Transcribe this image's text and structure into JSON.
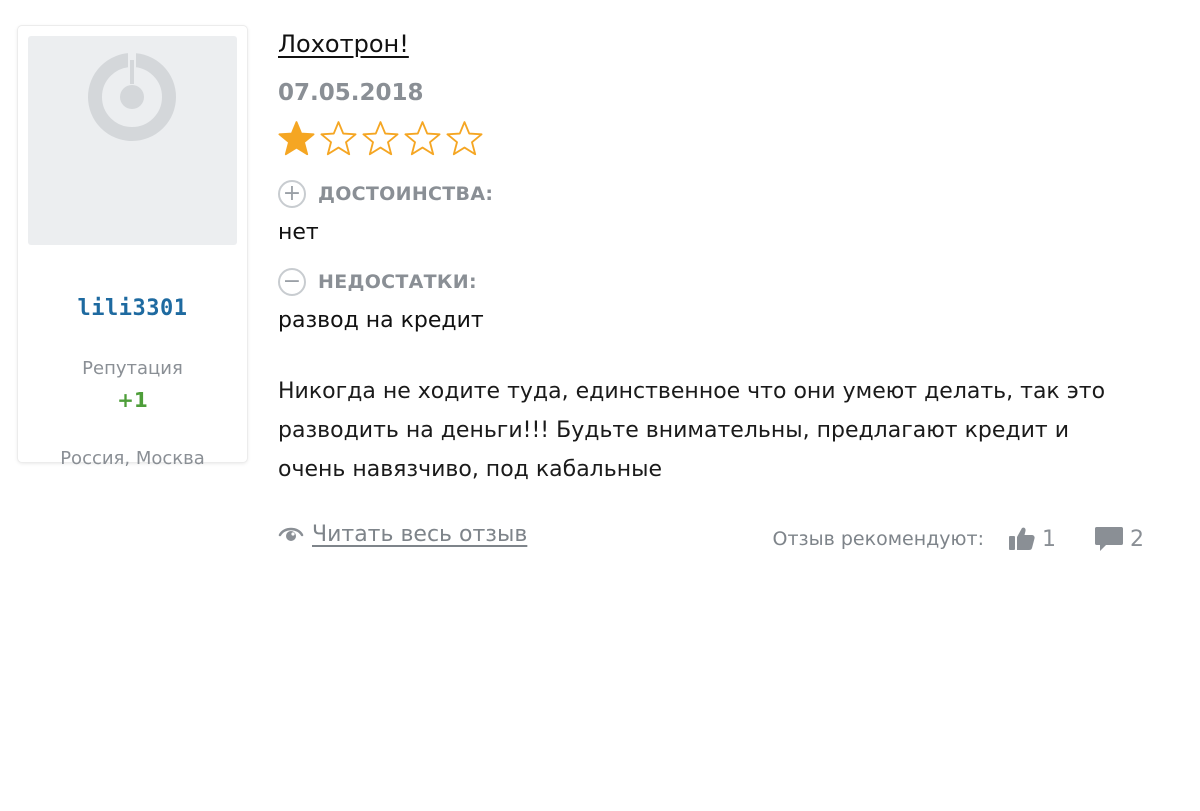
{
  "author": {
    "username": "lili3301",
    "reputation_label": "Репутация",
    "reputation_value": "+1",
    "location": "Россия, Москва"
  },
  "review": {
    "title": "Лохотрон!",
    "date": "07.05.2018",
    "rating": 1,
    "rating_max": 5,
    "pros_label": "ДОСТОИНСТВА:",
    "pros_text": "нет",
    "cons_label": "НЕДОСТАТКИ:",
    "cons_text": "развод на кредит",
    "body_lines": [
      "Никогда не ходите туда, единственное что они умеют делать, так это",
      "разводить на деньги!!! Будьте внимательны, предлагают кредит и",
      "очень навязчиво, под кабальные"
    ],
    "read_more_label": "Читать весь отзыв",
    "recommend_label": "Отзыв рекомендуют:",
    "likes_count": "1",
    "comments_count": "2"
  },
  "colors": {
    "star_filled": "#f5a623",
    "star_empty": "#f5a623",
    "username": "#1e6aa0",
    "reputation": "#4e9e3a",
    "muted": "#8a8f95"
  }
}
